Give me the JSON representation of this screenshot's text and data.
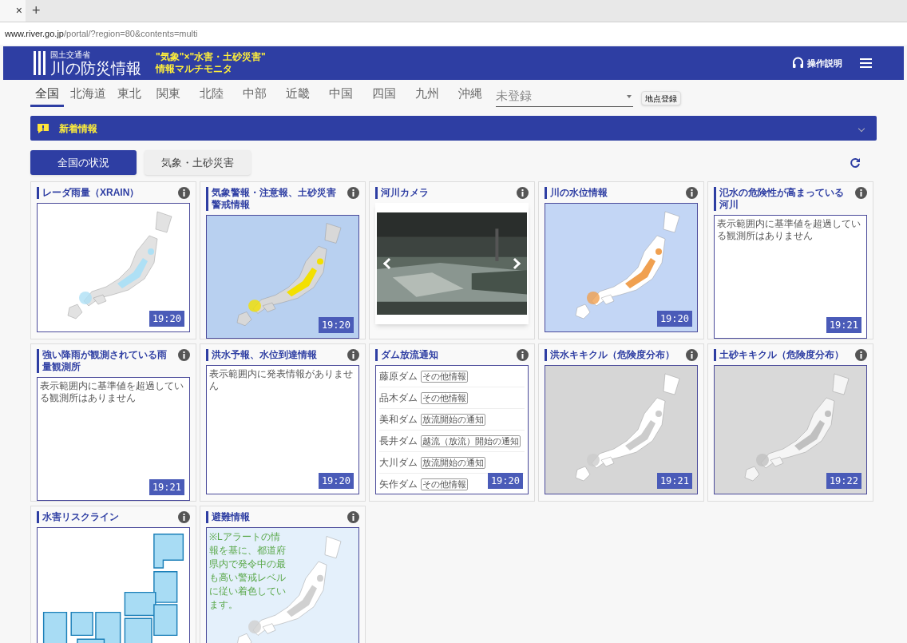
{
  "browser": {
    "url_host": "www.river.go.jp",
    "url_path": "/portal/?region=80&contents=multi",
    "new_tab": "+",
    "close_tab": "×"
  },
  "header": {
    "ministry": "国土交通省",
    "logo_text": "川の防災情報",
    "tagline": [
      "\"気象\"×\"水害・土砂災害\"",
      "情報マルチモニタ"
    ],
    "help": "操作説明"
  },
  "regions": [
    {
      "label": "全国",
      "selected": true
    },
    {
      "label": "北海道",
      "selected": false
    },
    {
      "label": "東北",
      "selected": false
    },
    {
      "label": "関東",
      "selected": false
    },
    {
      "label": "北陸",
      "selected": false
    },
    {
      "label": "中部",
      "selected": false
    },
    {
      "label": "近畿",
      "selected": false
    },
    {
      "label": "中国",
      "selected": false
    },
    {
      "label": "四国",
      "selected": false
    },
    {
      "label": "九州",
      "selected": false
    },
    {
      "label": "沖縄",
      "selected": false
    }
  ],
  "location_select": {
    "placeholder": "未登録",
    "button": "地点登録"
  },
  "news": {
    "title": "新着情報",
    "expanded": false
  },
  "view_tabs": [
    {
      "label": "全国の状況",
      "selected": true
    },
    {
      "label": "気象・土砂災害",
      "selected": false
    }
  ],
  "cards": [
    {
      "kind": "map",
      "title": "レーダ雨量（XRAIN）",
      "time": "19:20"
    },
    {
      "kind": "map",
      "title": "気象警報・注意報、土砂災害警戒情報",
      "time": "19:20"
    },
    {
      "kind": "camera",
      "title": "河川カメラ"
    },
    {
      "kind": "map",
      "title": "川の水位情報",
      "time": "19:20"
    },
    {
      "kind": "message",
      "title": "氾水の危険性が高まっている河川",
      "text": "表示範囲内に基準値を超過している観測所はありません",
      "time": "19:21"
    },
    {
      "kind": "message",
      "title": "強い降雨が観測されている雨量観測所",
      "text": "表示範囲内に基準値を超過している観測所はありません",
      "time": "19:21"
    },
    {
      "kind": "message",
      "title": "洪水予報、水位到達情報",
      "text": "表示範囲内に発表情報がありません",
      "time": "19:20"
    },
    {
      "kind": "dams",
      "title": "ダム放流通知",
      "time": "19:20",
      "rows": [
        {
          "name": "藤原ダム",
          "status": "その他情報"
        },
        {
          "name": "品木ダム",
          "status": "その他情報"
        },
        {
          "name": "美和ダム",
          "status": "放流開始の通知"
        },
        {
          "name": "長井ダム",
          "status": "越流（放流）開始の通知"
        },
        {
          "name": "大川ダム",
          "status": "放流開始の通知"
        },
        {
          "name": "矢作ダム",
          "status": "その他情報"
        }
      ]
    },
    {
      "kind": "map",
      "title": "洪水キキクル（危険度分布）",
      "time": "19:21"
    },
    {
      "kind": "map",
      "title": "土砂キキクル（危険度分布）",
      "time": "19:22"
    },
    {
      "kind": "riskline",
      "title": "水害リスクライン"
    },
    {
      "kind": "evacuation",
      "title": "避難情報",
      "text": "※Lアラートの情報を基に、都道府県内で発令中の最も高い警戒レベルに従い着色しています。"
    }
  ]
}
